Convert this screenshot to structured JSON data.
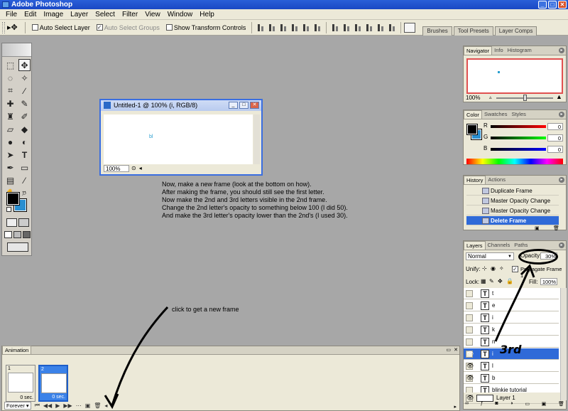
{
  "window": {
    "title": "Adobe Photoshop",
    "controls": [
      "_",
      "□",
      "✕"
    ]
  },
  "menu": [
    "File",
    "Edit",
    "Image",
    "Layer",
    "Select",
    "Filter",
    "View",
    "Window",
    "Help"
  ],
  "options_bar": {
    "tool_glyph": "▸✥",
    "auto_select_layer": "Auto Select Layer",
    "auto_select_groups": "Auto Select Groups",
    "show_transform_controls": "Show Transform Controls",
    "wells": [
      "Brushes",
      "Tool Presets",
      "Layer Comps"
    ]
  },
  "document": {
    "title": "Untitled-1 @ 100% (i, RGB/8)",
    "canvas_text": "bl",
    "zoom": "100%"
  },
  "instructions": [
    "Now, make a new frame (look at the bottom on how).",
    "After making the frame, you should still see the first letter.",
    "Now make the 2nd and 3rd letters visible in the 2nd frame.",
    "Change the 2nd letter's opacity to something below 100 (I did 50).",
    "And make the 3rd letter's opacity lower than the 2nd's (I used 30)."
  ],
  "click_note": "click to get a new frame",
  "annotation_3rd": "3rd",
  "navigator": {
    "tabs": [
      "Navigator",
      "Info",
      "Histogram"
    ],
    "zoom": "100%"
  },
  "color": {
    "tabs": [
      "Color",
      "Swatches",
      "Styles"
    ],
    "channels": [
      {
        "label": "R",
        "value": "0"
      },
      {
        "label": "G",
        "value": "0"
      },
      {
        "label": "B",
        "value": "0"
      }
    ]
  },
  "history": {
    "tabs": [
      "History",
      "Actions"
    ],
    "items": [
      "Duplicate Frame",
      "Master Opacity Change",
      "Master Opacity Change",
      "Delete Frame"
    ],
    "selected_index": 3
  },
  "layers": {
    "tabs": [
      "Layers",
      "Channels",
      "Paths"
    ],
    "blend_mode": "Normal",
    "opacity_label": "Opacity:",
    "opacity_value": "30%",
    "unify_label": "Unify:",
    "propagate_label": "Propagate Frame 1",
    "lock_label": "Lock:",
    "fill_label": "Fill:",
    "fill_value": "100%",
    "rows": [
      {
        "name": "t",
        "type": "T",
        "visible": false,
        "selected": false
      },
      {
        "name": "e",
        "type": "T",
        "visible": false,
        "selected": false
      },
      {
        "name": "i",
        "type": "T",
        "visible": false,
        "selected": false
      },
      {
        "name": "k",
        "type": "T",
        "visible": false,
        "selected": false
      },
      {
        "name": "n",
        "type": "T",
        "visible": false,
        "selected": false
      },
      {
        "name": "i",
        "type": "T",
        "visible": true,
        "selected": true
      },
      {
        "name": "l",
        "type": "T",
        "visible": true,
        "selected": false
      },
      {
        "name": "b",
        "type": "T",
        "visible": true,
        "selected": false
      },
      {
        "name": "blinkie tutorial",
        "type": "T",
        "visible": false,
        "selected": false
      },
      {
        "name": "Layer 1",
        "type": "raster",
        "visible": true,
        "selected": false
      }
    ]
  },
  "animation": {
    "tab": "Animation",
    "frames": [
      {
        "num": "1",
        "delay": "0 sec.",
        "selected": false
      },
      {
        "num": "2",
        "delay": "0 sec.",
        "selected": true
      }
    ],
    "loop": "Forever"
  },
  "colors": {
    "accent": "#2f6ad8",
    "title_bar": "#1a48c4",
    "workspace": "#a7a7a7",
    "foreground": "#000000",
    "background": "#2a8fd0"
  }
}
